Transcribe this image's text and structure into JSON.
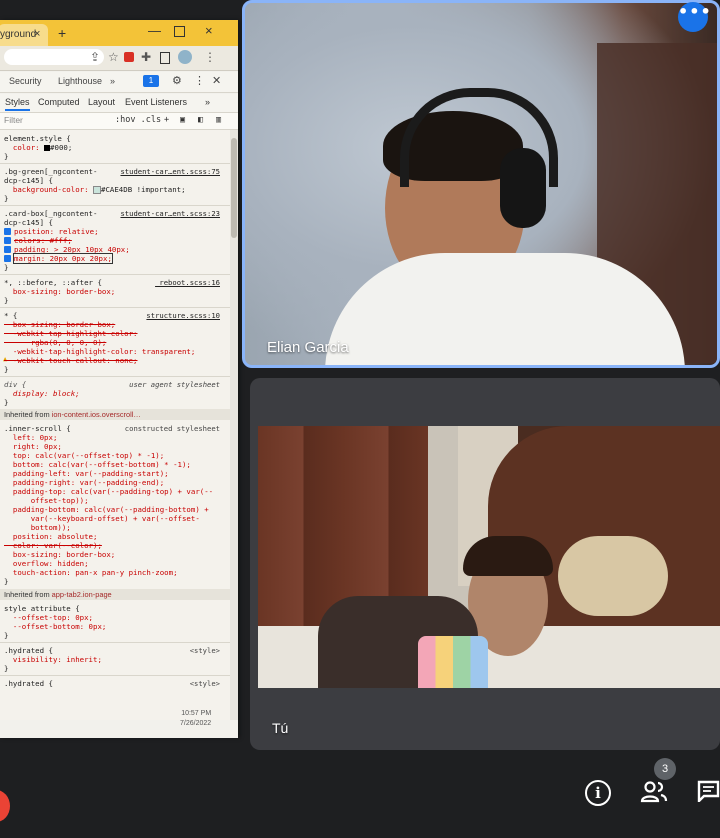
{
  "browser": {
    "tab_title": "yground",
    "tab_close": "×",
    "new_tab": "+",
    "window_controls": [
      "—",
      "×"
    ]
  },
  "devtools": {
    "panel_tabs": [
      "Security",
      "Lighthouse",
      "»"
    ],
    "issues_badge": "1",
    "sub_tabs": [
      "Styles",
      "Computed",
      "Layout",
      "Event Listeners",
      "»"
    ],
    "filter_placeholder": "Filter",
    "filter_tools": ":hov .cls",
    "rules": [
      {
        "selector": "element.style {",
        "source": ""
      },
      {
        "prop": "  color: ",
        "value": "#000;"
      },
      {
        "close": "}"
      },
      {
        "selector": ".bg-green[_ngcontent-",
        "source": "student-car…ent.scss:75"
      },
      {
        "selector_cont": "dcp-c145] {"
      },
      {
        "prop": "  background-color: ",
        "value": "#CAE4DB !important;"
      },
      {
        "close": "}"
      },
      {
        "selector": ".card-box[_ngcontent-",
        "source": "student-car…ent.scss:23"
      },
      {
        "selector_cont": "dcp-c145] {"
      },
      {
        "prop": "position: relative;"
      },
      {
        "prop_struck": "colors: #fff;"
      },
      {
        "prop": "padding: > 20px 10px 40px;"
      },
      {
        "prop": "margin: 20px 0px 20px;"
      },
      {
        "close": "}"
      },
      {
        "selector": "*, ::before, ::after {",
        "source": "_reboot.scss:16"
      },
      {
        "prop": "  box-sizing: border-box;"
      },
      {
        "close": "}"
      },
      {
        "selector": "* {",
        "source": "structure.scss:10"
      },
      {
        "prop_struck": "  box-sizing: border-box;"
      },
      {
        "prop_struck": "  -webkit-tap-highlight-color:"
      },
      {
        "prop_struck": "      rgba(0, 0, 0, 0);"
      },
      {
        "prop": "  -webkit-tap-highlight-color: transparent;"
      },
      {
        "prop_struck": "  -webkit-touch-callout: none;"
      },
      {
        "close": "}"
      },
      {
        "selector": "div {",
        "source": "user agent stylesheet"
      },
      {
        "prop": "  display: block;"
      },
      {
        "close": "}"
      }
    ],
    "inherited_1": "Inherited from",
    "inherited_1_target": "ion-content.ios.overscroll…",
    "inner_scroll": {
      "selector": ".inner-scroll {",
      "source": "constructed stylesheet",
      "lines": [
        "  left: 0px;",
        "  right: 0px;",
        "  top: calc(var(--offset-top) * -1);",
        "  bottom: calc(var(--offset-bottom) * -1);",
        "  padding-left: var(--padding-start);",
        "  padding-right: var(--padding-end);",
        "  padding-top: calc(var(--padding-top) + var(--",
        "      offset-top));",
        "  padding-bottom: calc(var(--padding-bottom) +",
        "      var(--keyboard-offset) + var(--offset-",
        "      bottom));",
        "  position: absolute;"
      ],
      "struck": "  color: var(--color);",
      "more": [
        "  box-sizing: border-box;",
        "  overflow: hidden;",
        "  touch-action: pan-x pan-y pinch-zoom;"
      ]
    },
    "inherited_2": "Inherited from",
    "inherited_2_target": "app-tab2.ion-page",
    "style_attr": {
      "selector": "style attribute {",
      "lines": [
        "  --offset-top: 0px;",
        "  --offset-bottom: 0px;"
      ]
    },
    "hydrated_1": {
      "selector": ".hydrated {",
      "source": "<style>",
      "line": "  visibility: inherit;"
    },
    "hydrated_2": {
      "selector": ".hydrated {",
      "source": "<style>"
    },
    "close_brace": "}",
    "clock_time": "10:57 PM",
    "clock_date": "7/26/2022"
  },
  "meet": {
    "tile1_name": "Elian Garcia",
    "tile2_name": "Tú",
    "more_options": "•••",
    "info_label": "i",
    "participant_count": "3"
  },
  "colors": {
    "accent_blue": "#8ab4f8",
    "meet_blue": "#1a73e8",
    "swatch_black": "#000000",
    "swatch_green": "#CAE4DB"
  }
}
